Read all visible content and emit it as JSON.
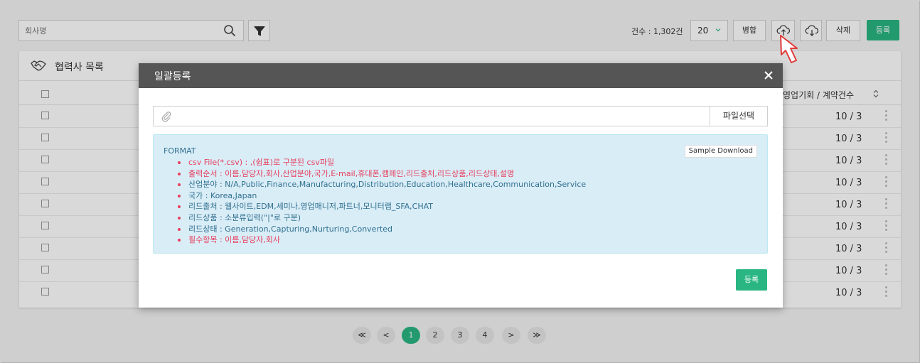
{
  "toolbar": {
    "search_placeholder": "회사명",
    "count_text": "건수 : 1,302건",
    "page_size": "20",
    "merge_label": "병합",
    "delete_label": "삭제",
    "register_label": "등록"
  },
  "panel": {
    "title": "협력사 목록",
    "column_label": "영업기회 / 계약건수",
    "rows": [
      "10 / 3",
      "10 / 3",
      "10 / 3",
      "10 / 3",
      "10 / 3",
      "10 / 3",
      "10 / 3",
      "10 / 3",
      "10 / 3"
    ]
  },
  "pagination": {
    "first": "≪",
    "prev": "<",
    "pages": [
      "1",
      "2",
      "3",
      "4"
    ],
    "active": "1",
    "next": ">",
    "last": "≫"
  },
  "modal": {
    "title": "일괄등록",
    "close": "✕",
    "file_button": "파일선택",
    "format_label": "FORMAT",
    "sample_download": "Sample Download",
    "items": [
      "csv File(*.csv) : ,(쉼표)로 구분된 csv파일",
      "출력순서 : 이름,담당자,회사,산업분야,국가,E-mail,휴대폰,캠페인,리드출처,리드상품,리드상태,설명",
      "산업분야 : N/A,Public,Finance,Manufacturing,Distribution,Education,Healthcare,Communication,Service",
      "국가 : Korea,Japan",
      "리드출처 : 웹사이트,EDM,세미나,영업매니저,파트너,모니터랩_SFA,CHAT",
      "리드상품 : 소분류입력(\"|\"로 구분)",
      "리드상태 : Generation,Capturing,Nurturing,Converted",
      "필수항목 : 이름,담당자,회사"
    ],
    "submit_label": "등록"
  },
  "colors": {
    "accent": "#2ab682",
    "modal_header": "#555555",
    "info_bg": "#d9edf7",
    "info_text": "#31708f",
    "required_text": "#e83e5c"
  },
  "icons": {
    "search": "search-icon",
    "filter": "filter-icon",
    "upload": "cloud-upload-icon",
    "download": "cloud-download-icon",
    "partner": "handshake-icon",
    "attach": "paperclip-icon",
    "close": "close-icon",
    "sort": "sort-icon",
    "more": "more-vertical-icon",
    "cursor": "pointer-cursor-icon"
  }
}
